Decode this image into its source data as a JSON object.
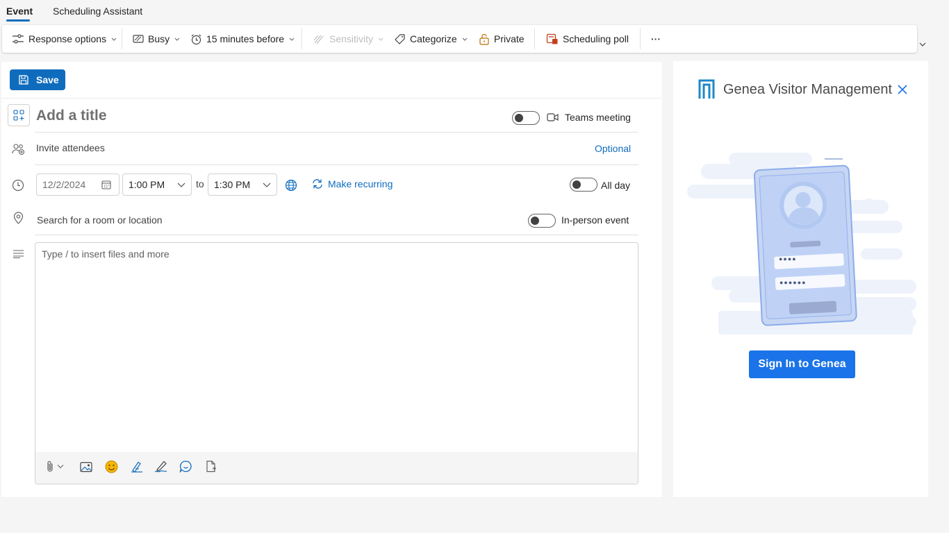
{
  "tabs": [
    {
      "label": "Event",
      "active": true
    },
    {
      "label": "Scheduling Assistant",
      "active": false
    }
  ],
  "toolbar": {
    "response_options": "Response options",
    "show_as": "Busy",
    "reminder": "15 minutes before",
    "sensitivity": "Sensitivity",
    "categorize": "Categorize",
    "private": "Private",
    "scheduling_poll": "Scheduling poll",
    "more": "···"
  },
  "form": {
    "save_label": "Save",
    "title_placeholder": "Add a title",
    "teams_meeting_label": "Teams meeting",
    "teams_meeting_on": false,
    "attendees_placeholder": "Invite attendees",
    "optional_label": "Optional",
    "date": "12/2/2024",
    "start_time": "1:00 PM",
    "to_label": "to",
    "end_time": "1:30 PM",
    "make_recurring": "Make recurring",
    "all_day_label": "All day",
    "all_day_on": false,
    "location_placeholder": "Search for a room or location",
    "in_person_label": "In-person event",
    "in_person_on": false,
    "body_placeholder": "Type / to insert files and more"
  },
  "side_panel": {
    "brand_name": "Genea Visitor Management",
    "pin_dots_1": "●●●●",
    "pin_dots_2": "●●●●●●",
    "signin_label": "Sign In to Genea"
  },
  "colors": {
    "accent": "#0f6cbd",
    "genea_blue": "#1a73e8",
    "genea_logo": "#1e88c8"
  }
}
